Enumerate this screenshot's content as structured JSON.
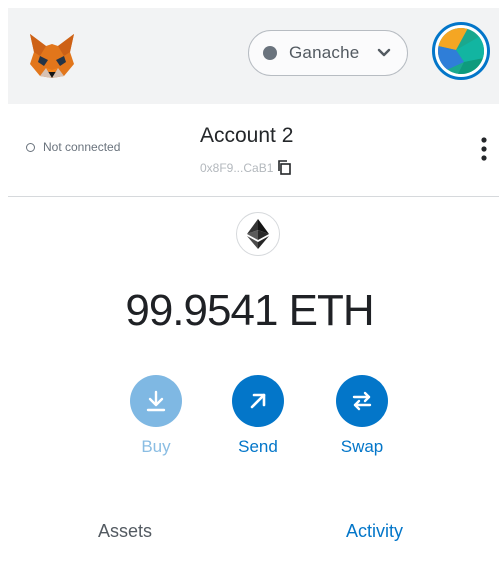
{
  "header": {
    "network_label": "Ganache"
  },
  "account": {
    "connection_status": "Not connected",
    "name": "Account 2",
    "address": "0x8F9...CaB1"
  },
  "balance": {
    "amount": "99.9541 ETH"
  },
  "actions": [
    {
      "label": "Buy",
      "icon": "download-icon"
    },
    {
      "label": "Send",
      "icon": "arrow-up-right-icon"
    },
    {
      "label": "Swap",
      "icon": "swap-arrows-icon"
    }
  ],
  "tabs": [
    {
      "label": "Assets",
      "active": false
    },
    {
      "label": "Activity",
      "active": true
    }
  ],
  "colors": {
    "accent": "#0376c9",
    "buy_disabled": "#7fb8e3",
    "header_bg": "#f2f3f4"
  }
}
